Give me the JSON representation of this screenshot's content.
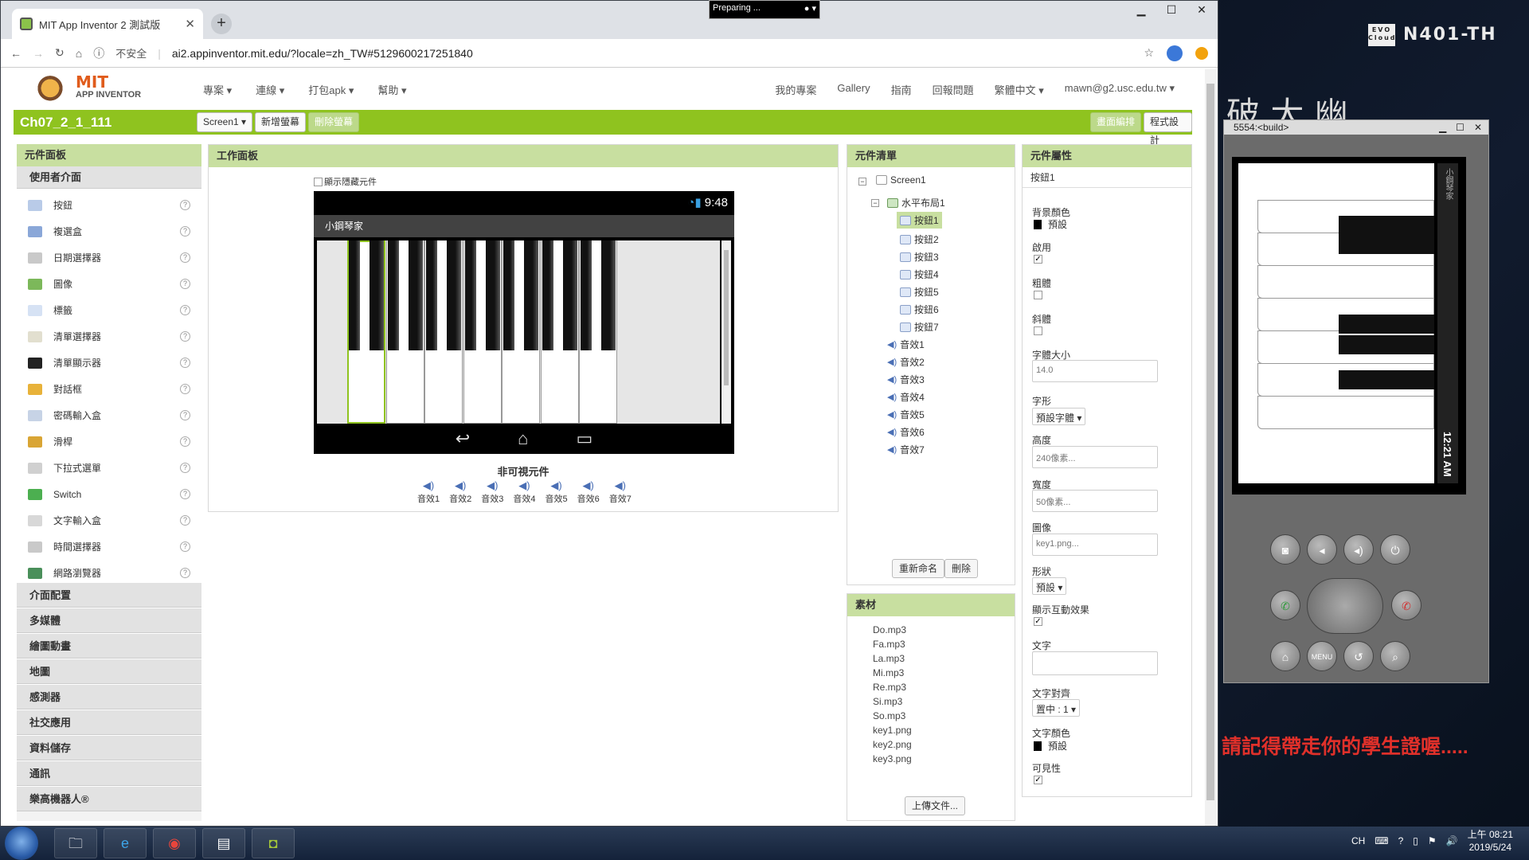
{
  "browser": {
    "tab_title": "MIT App Inventor 2 測試版",
    "security": "不安全",
    "url": "ai2.appinventor.mit.edu/?locale=zh_TW#5129600217251840"
  },
  "topnav": {
    "logo_line1": "MIT",
    "logo_line2": "APP INVENTOR",
    "left_menus": [
      "專案 ▾",
      "連線 ▾",
      "打包apk ▾",
      "幫助 ▾"
    ],
    "right_menus": [
      "我的專案",
      "Gallery",
      "指南",
      "回報問題",
      "繁體中文 ▾",
      "mawn@g2.usc.edu.tw ▾"
    ]
  },
  "toolbar": {
    "project_name": "Ch07_2_1_111",
    "screen_select": "Screen1 ▾",
    "add_screen": "新增螢幕",
    "remove_screen": "刪除螢幕",
    "designer": "畫面編排",
    "blocks": "程式設計"
  },
  "palette": {
    "title": "元件面板",
    "section": "使用者介面",
    "items": [
      {
        "label": "按鈕",
        "icon": "button-icon",
        "color": "#b9cbe8"
      },
      {
        "label": "複選盒",
        "icon": "checkbox-icon",
        "color": "#8aa7d8"
      },
      {
        "label": "日期選擇器",
        "icon": "calendar-icon",
        "color": "#c9c9c9"
      },
      {
        "label": "圖像",
        "icon": "image-icon",
        "color": "#7cb85a"
      },
      {
        "label": "標籤",
        "icon": "label-icon",
        "color": "#d6e2f4"
      },
      {
        "label": "清單選擇器",
        "icon": "list-picker-icon",
        "color": "#e2dfcf"
      },
      {
        "label": "清單顯示器",
        "icon": "list-view-icon",
        "color": "#222222"
      },
      {
        "label": "對話框",
        "icon": "warning-icon",
        "color": "#e8b23a"
      },
      {
        "label": "密碼輸入盒",
        "icon": "password-icon",
        "color": "#c7d3e6"
      },
      {
        "label": "滑桿",
        "icon": "slider-icon",
        "color": "#d9a534"
      },
      {
        "label": "下拉式選單",
        "icon": "spinner-icon",
        "color": "#d0d0d0"
      },
      {
        "label": "Switch",
        "icon": "switch-icon",
        "color": "#4caf50"
      },
      {
        "label": "文字輸入盒",
        "icon": "textbox-icon",
        "color": "#d8d8d8"
      },
      {
        "label": "時間選擇器",
        "icon": "clock-icon",
        "color": "#c9c9c9"
      },
      {
        "label": "網路瀏覽器",
        "icon": "web-icon",
        "color": "#4a8f5a"
      }
    ],
    "categories": [
      "介面配置",
      "多媒體",
      "繪圖動畫",
      "地圖",
      "感測器",
      "社交應用",
      "資料儲存",
      "通訊",
      "樂高機器人®"
    ]
  },
  "viewer": {
    "title": "工作面板",
    "show_hidden": "顯示隱藏元件",
    "time": "9:48",
    "app_title": "小鋼琴家",
    "nonvisible_title": "非可視元件",
    "sounds": [
      "音效1",
      "音效2",
      "音效3",
      "音效4",
      "音效5",
      "音效6",
      "音效7"
    ]
  },
  "tree": {
    "title": "元件清單",
    "screen": "Screen1",
    "arrangement": "水平布局1",
    "buttons": [
      "按鈕1",
      "按鈕2",
      "按鈕3",
      "按鈕4",
      "按鈕5",
      "按鈕6",
      "按鈕7"
    ],
    "sounds": [
      "音效1",
      "音效2",
      "音效3",
      "音效4",
      "音效5",
      "音效6",
      "音效7"
    ],
    "rename": "重新命名",
    "delete": "刪除"
  },
  "media": {
    "title": "素材",
    "files": [
      "Do.mp3",
      "Fa.mp3",
      "La.mp3",
      "Mi.mp3",
      "Re.mp3",
      "Si.mp3",
      "So.mp3",
      "key1.png",
      "key2.png",
      "key3.png"
    ],
    "upload": "上傳文件..."
  },
  "properties": {
    "title": "元件屬性",
    "component": "按鈕1",
    "bg_label": "背景顏色",
    "bg_value": "預設",
    "enabled_label": "啟用",
    "bold_label": "粗體",
    "italic_label": "斜體",
    "fontsize_label": "字體大小",
    "fontsize_value": "14.0",
    "font_label": "字形",
    "font_value": "預設字體 ▾",
    "height_label": "高度",
    "height_value": "240像素...",
    "width_label": "寬度",
    "width_value": "50像素...",
    "image_label": "圖像",
    "image_value": "key1.png...",
    "shape_label": "形狀",
    "shape_value": "預設 ▾",
    "feedback_label": "顯示互動效果",
    "text_label": "文字",
    "text_value": "",
    "align_label": "文字對齊",
    "align_value": "置中 : 1 ▾",
    "textcolor_label": "文字顏色",
    "textcolor_value": "預設",
    "visible_label": "可見性"
  },
  "emulator": {
    "title": "5554:<build>",
    "app_title": "小鋼琴家",
    "time": "12:21 AM"
  },
  "desktop": {
    "computer_name": "N401-TH",
    "evo_label": "EVO Cloud",
    "preparing": "Preparing ...",
    "reminder": "請記得帶走你的學生證喔.....",
    "calligraphy": "破 大 幽"
  },
  "taskbar": {
    "lang": "CH",
    "time": "上午 08:21",
    "date": "2019/5/24"
  }
}
